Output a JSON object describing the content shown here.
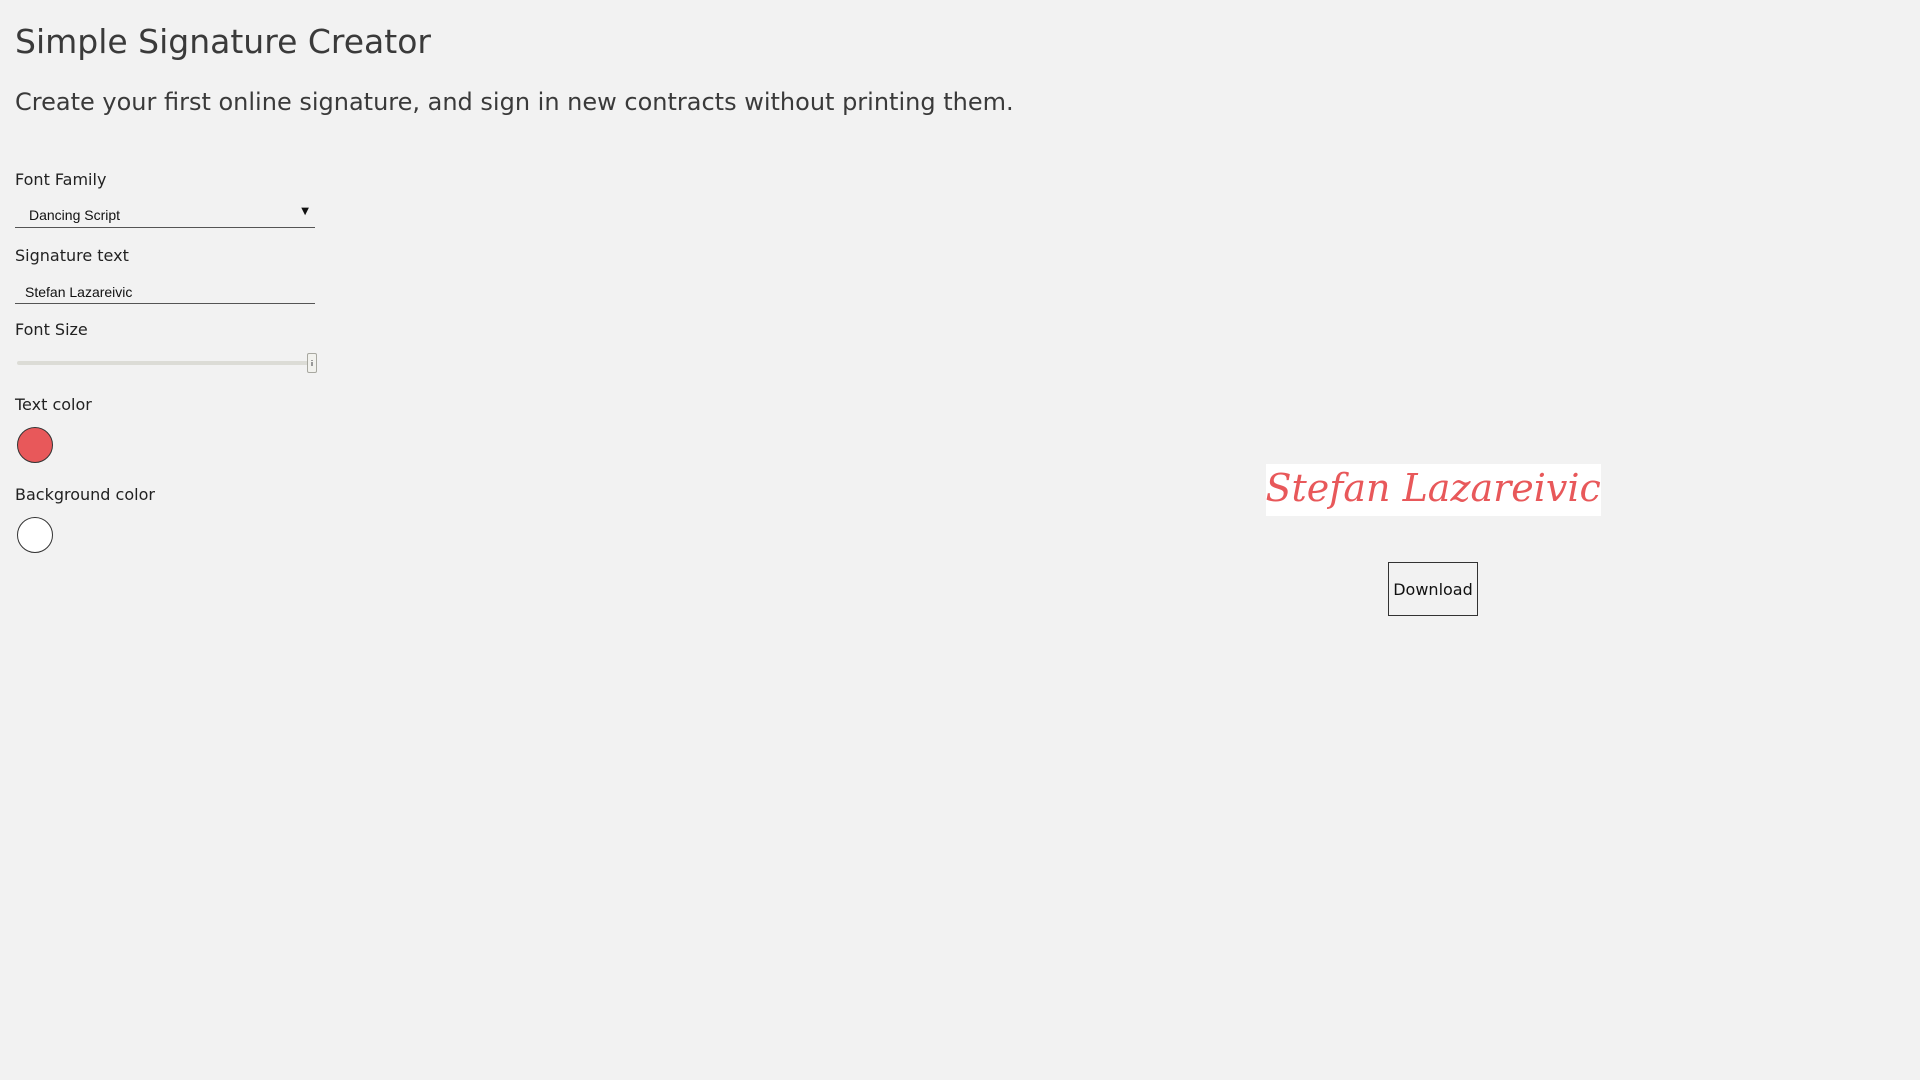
{
  "header": {
    "title": "Simple Signature Creator",
    "subtitle": "Create your first online signature, and sign in new contracts without printing them."
  },
  "controls": {
    "font_family": {
      "label": "Font Family",
      "selected": "Dancing Script"
    },
    "signature_text": {
      "label": "Signature text",
      "value": "Stefan Lazareivic"
    },
    "font_size": {
      "label": "Font Size",
      "level": 1.0
    },
    "text_color": {
      "label": "Text color",
      "value": "#e8585a"
    },
    "background_color": {
      "label": "Background color",
      "value": "#ffffff"
    }
  },
  "preview": {
    "text": "Stefan Lazareivic",
    "color": "#e8585a",
    "background": "#ffffff"
  },
  "actions": {
    "download_label": "Download"
  }
}
